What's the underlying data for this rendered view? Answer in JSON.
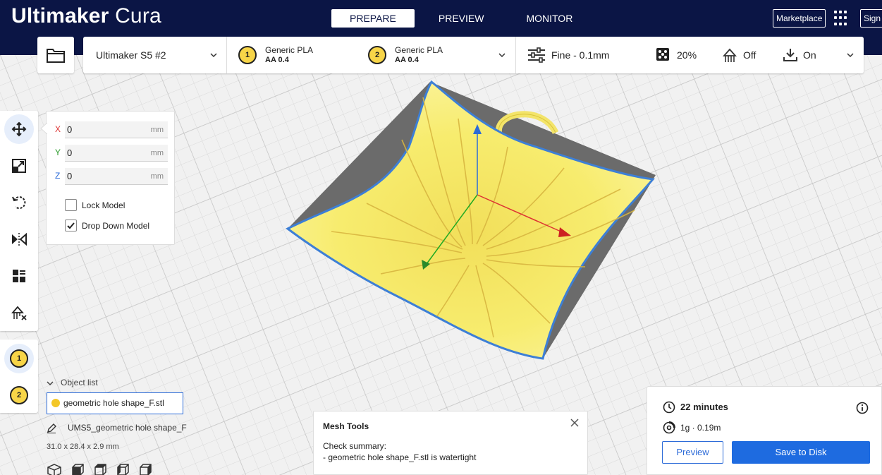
{
  "app": {
    "brand_bold": "Ultimaker",
    "brand_light": " Cura"
  },
  "stages": [
    {
      "label": "PREPARE",
      "active": true
    },
    {
      "label": "PREVIEW",
      "active": false
    },
    {
      "label": "MONITOR",
      "active": false
    }
  ],
  "header_right": {
    "marketplace_label": "Marketplace",
    "sign_label": "Sign"
  },
  "printer": {
    "name": "Ultimaker S5 #2"
  },
  "extruders": [
    {
      "index": "1",
      "material": "Generic PLA",
      "nozzle": "AA 0.4"
    },
    {
      "index": "2",
      "material": "Generic PLA",
      "nozzle": "AA 0.4"
    }
  ],
  "print_settings": {
    "profile": "Fine - 0.1mm",
    "infill": "20%",
    "support": "Off",
    "adhesion": "On"
  },
  "move_panel": {
    "x": {
      "label": "X",
      "value": "0",
      "unit": "mm"
    },
    "y": {
      "label": "Y",
      "value": "0",
      "unit": "mm"
    },
    "z": {
      "label": "Z",
      "value": "0",
      "unit": "mm"
    },
    "lock_model": {
      "label": "Lock Model",
      "checked": false
    },
    "drop_down": {
      "label": "Drop Down Model",
      "checked": true
    }
  },
  "left_extruders": [
    "1",
    "2"
  ],
  "object_list": {
    "header": "Object list",
    "item": "geometric hole shape_F.stl",
    "job_name": "UMS5_geometric hole shape_F",
    "dimensions": "31.0 x 28.4 x 2.9 mm"
  },
  "mesh_tools": {
    "title": "Mesh Tools",
    "line1": "Check summary:",
    "line2": "- geometric hole shape_F.stl is watertight"
  },
  "action_panel": {
    "time": "22 minutes",
    "material": "1g · 0.19m",
    "preview_label": "Preview",
    "save_label": "Save to Disk"
  },
  "colors": {
    "header_bg": "#0b1545",
    "accent": "#1e6be0",
    "model": "#f7ec6e",
    "extruder_badge": "#f7d548"
  }
}
